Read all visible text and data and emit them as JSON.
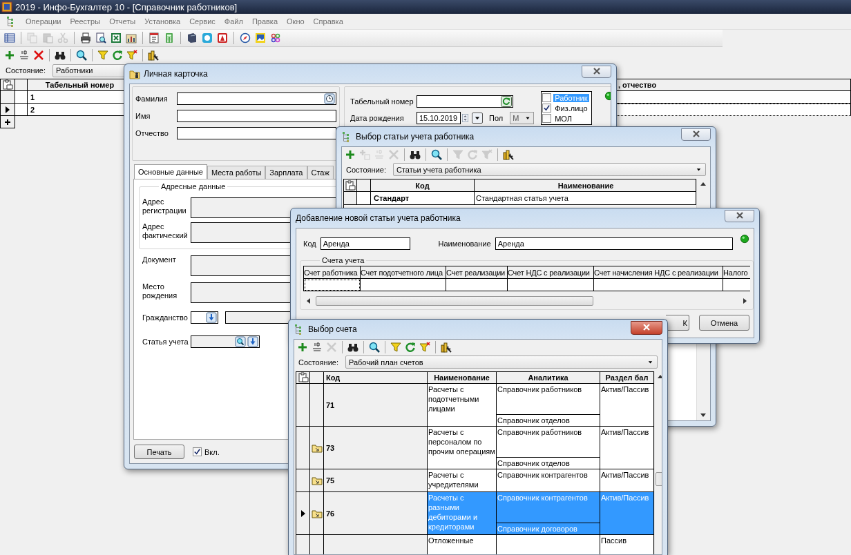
{
  "app": {
    "title": "2019 - Инфо-Бухгалтер 10 - [Справочник работников]",
    "menu": [
      {
        "label": "Операции",
        "disabled": true
      },
      {
        "label": "Реестры",
        "disabled": true
      },
      {
        "label": "Отчеты",
        "disabled": true
      },
      {
        "label": "Установка",
        "disabled": true
      },
      {
        "label": "Сервис",
        "disabled": true
      },
      {
        "label": "Файл",
        "disabled": true
      },
      {
        "label": "Правка",
        "disabled": true
      },
      {
        "label": "Окно",
        "disabled": true
      },
      {
        "label": "Справка",
        "disabled": true
      }
    ],
    "toolbar": [
      {
        "disabled": false
      },
      {
        "disabled": true
      },
      {
        "disabled": true
      },
      {
        "disabled": true
      },
      {
        "disabled": false
      },
      {
        "disabled": false
      },
      {
        "disabled": false
      },
      {
        "disabled": false
      },
      {
        "disabled": false
      },
      {
        "disabled": false
      },
      {
        "disabled": false
      },
      {
        "disabled": false
      },
      {
        "disabled": false
      },
      {
        "disabled": false
      },
      {
        "disabled": false
      },
      {
        "disabled": false
      }
    ]
  },
  "employees": {
    "toolbar": [
      {
        "disabled": false
      },
      {
        "disabled": false
      },
      {
        "disabled": false
      },
      {
        "disabled": false
      },
      {
        "disabled": false
      },
      {
        "disabled": false
      },
      {
        "disabled": false
      },
      {
        "disabled": false
      },
      {
        "disabled": false
      }
    ],
    "state": {
      "label": "Состояние:",
      "value": "Работники"
    },
    "columns": [
      "Табельный номер",
      ", отчество"
    ],
    "rows": [
      {
        "number": "1",
        "selected": false
      },
      {
        "number": "2",
        "selected": true
      }
    ]
  },
  "card": {
    "title": "Личная карточка",
    "fields": [
      {
        "label": "Фамилия"
      },
      {
        "label": "Имя"
      },
      {
        "label": "Отчество"
      }
    ],
    "tab_number": {
      "label": "Табельный номер"
    },
    "birth_date": {
      "label": "Дата рождения",
      "value": "15.10.2019"
    },
    "gender": {
      "label": "Пол",
      "value": "М"
    },
    "roles": [
      {
        "label": "Работник",
        "checked": false,
        "selected": true
      },
      {
        "label": "Физ.лицо",
        "checked": true,
        "selected": false
      },
      {
        "label": "МОЛ",
        "checked": false,
        "selected": false
      }
    ],
    "tabs": [
      {
        "label": "Основные данные",
        "selected": true
      },
      {
        "label": "Места работы",
        "selected": false
      },
      {
        "label": "Зарплата",
        "selected": false
      },
      {
        "label": "Стаж",
        "selected": false
      }
    ],
    "address_group": {
      "title": "Адресные данные",
      "fields": [
        {
          "label": "Адрес регистрации"
        },
        {
          "label": "Адрес фактический"
        }
      ]
    },
    "details": [
      {
        "label": "Документ"
      },
      {
        "label": "Место рождения"
      }
    ],
    "citizenship": {
      "label": "Гражданство"
    },
    "account_item": {
      "label": "Статья учета"
    },
    "print_button": "Печать",
    "enabled": {
      "label": "Вкл.",
      "checked": true
    }
  },
  "item_picker": {
    "title": "Выбор статьи учета работника",
    "toolbar": [
      {
        "disabled": false
      },
      {
        "disabled": true
      },
      {
        "disabled": true
      },
      {
        "disabled": true
      },
      {
        "disabled": false
      },
      {
        "disabled": false
      },
      {
        "disabled": true
      },
      {
        "disabled": true
      },
      {
        "disabled": true
      },
      {
        "disabled": false
      }
    ],
    "state": {
      "label": "Состояние:",
      "value": "Статьи учета работника"
    },
    "columns": [
      "Код",
      "Наименование"
    ],
    "rows": [
      {
        "code": "Стандарт",
        "name": "Стандартная статья учета"
      }
    ]
  },
  "new_item": {
    "title": "Добавление новой статьи учета работника",
    "code": {
      "label": "Код",
      "value": "Аренда"
    },
    "name": {
      "label": "Наименование",
      "value": "Аренда"
    },
    "group_title": "Счета учета",
    "columns": [
      "Счет работника",
      "Счет подотчетного лица",
      "Счет реализации",
      "Счет НДС с реализации",
      "Счет начисления НДС с реализации",
      "Налого"
    ],
    "buttons": [
      "К",
      "Отмена"
    ]
  },
  "account_picker": {
    "title": "Выбор счета",
    "toolbar": [
      {
        "disabled": false
      },
      {
        "disabled": false
      },
      {
        "disabled": true
      },
      {
        "disabled": false
      },
      {
        "disabled": false
      },
      {
        "disabled": false
      },
      {
        "disabled": false
      },
      {
        "disabled": false
      },
      {
        "disabled": false
      }
    ],
    "state": {
      "label": "Состояние:",
      "value": "Рабочий план счетов"
    },
    "columns": [
      "Код",
      "Наименование",
      "Аналитика",
      "Раздел бал"
    ],
    "rows": [
      {
        "code": "71",
        "folder": false,
        "selected": false,
        "name": "Расчеты с подотчетными лицами",
        "analytics": [
          "Справочник работников",
          "Справочник отделов"
        ],
        "section": "Актив/Пассив"
      },
      {
        "code": "73",
        "folder": true,
        "selected": false,
        "name": "Расчеты с персоналом по прочим операциям",
        "analytics": [
          "Справочник работников",
          "Справочник отделов"
        ],
        "section": "Актив/Пассив"
      },
      {
        "code": "75",
        "folder": true,
        "selected": false,
        "name": "Расчеты с учредителями",
        "analytics": [
          "Справочник контрагентов"
        ],
        "section": "Актив/Пассив"
      },
      {
        "code": "76",
        "folder": true,
        "selected": true,
        "name": "Расчеты с разными дебиторами и кредиторами",
        "analytics": [
          "Справочник контрагентов",
          "Справочник договоров"
        ],
        "section": "Актив/Пассив"
      },
      {
        "folder": false,
        "selected": false,
        "name": "Отложенные",
        "section": "Пассив"
      }
    ]
  }
}
